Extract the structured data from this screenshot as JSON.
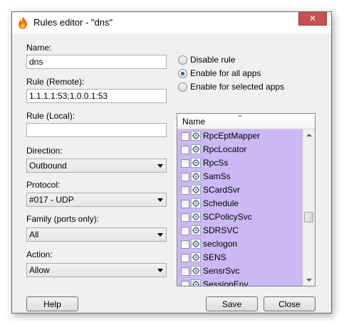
{
  "window": {
    "title": "Rules editor - \"dns\"",
    "close_label": "✕"
  },
  "form": {
    "name_label": "Name:",
    "name_value": "dns",
    "rule_remote_label": "Rule (Remote):",
    "rule_remote_value": "1.1.1.1:53;1.0.0.1:53",
    "rule_local_label": "Rule (Local):",
    "rule_local_value": "",
    "direction_label": "Direction:",
    "direction_value": "Outbound",
    "protocol_label": "Protocol:",
    "protocol_value": "#017 - UDP",
    "family_label": "Family (ports only):",
    "family_value": "All",
    "action_label": "Action:",
    "action_value": "Allow"
  },
  "options": {
    "disable": "Disable rule",
    "enable_all": "Enable for all apps",
    "enable_selected": "Enable for selected apps",
    "selected": "enable_all"
  },
  "apps_list": {
    "header": "Name",
    "items": [
      "RpcEptMapper",
      "RpcLocator",
      "RpcSs",
      "SamSs",
      "SCardSvr",
      "Schedule",
      "SCPolicySvc",
      "SDRSVC",
      "seclogon",
      "SENS",
      "SensrSvc",
      "SessionEnv"
    ],
    "highlight_color": "#cbb8f5"
  },
  "buttons": {
    "help": "Help",
    "save": "Save",
    "close": "Close"
  }
}
